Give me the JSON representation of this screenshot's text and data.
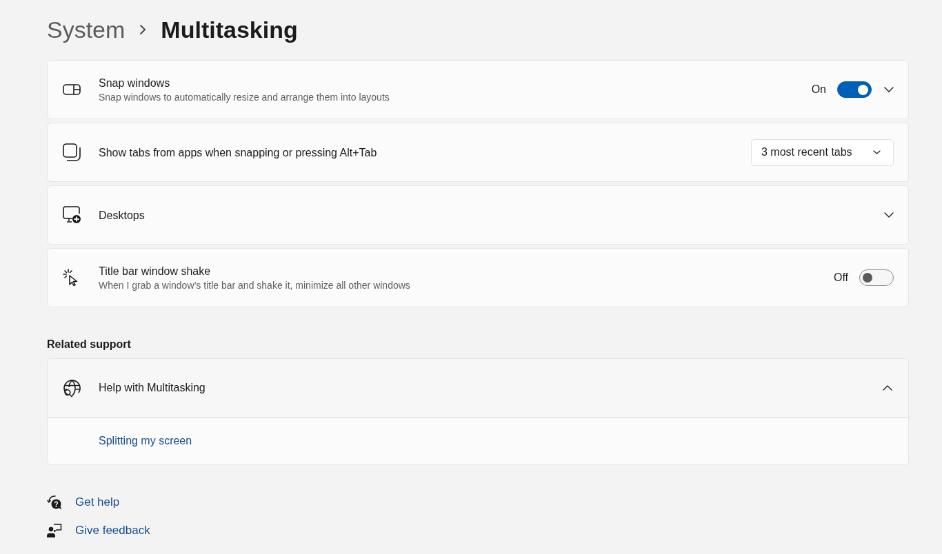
{
  "breadcrumb": {
    "parent": "System",
    "current": "Multitasking"
  },
  "settings": [
    {
      "kind": "toggle",
      "title": "Snap windows",
      "description": "Snap windows to automatically resize and arrange them into layouts",
      "state_label": "On",
      "on": true,
      "expanded": false
    },
    {
      "kind": "dropdown",
      "title": "Show tabs from apps when snapping or pressing Alt+Tab",
      "value": "3 most recent tabs"
    },
    {
      "kind": "expander",
      "title": "Desktops",
      "expanded": false
    },
    {
      "kind": "toggle",
      "title": "Title bar window shake",
      "description": "When I grab a window’s title bar and shake it, minimize all other windows",
      "state_label": "Off",
      "on": false
    }
  ],
  "related_support": {
    "heading": "Related support",
    "section": {
      "title": "Help with Multitasking",
      "expanded": true,
      "links": [
        "Splitting my screen"
      ]
    }
  },
  "footer_links": [
    {
      "kind": "help",
      "label": "Get help"
    },
    {
      "kind": "feedback",
      "label": "Give feedback"
    }
  ]
}
